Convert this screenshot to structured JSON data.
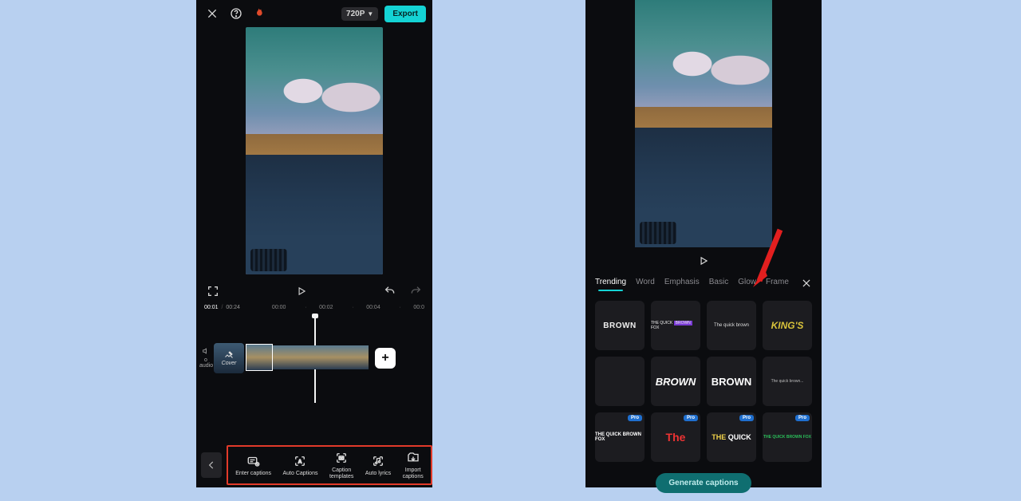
{
  "left": {
    "topbar": {
      "close_icon": "close",
      "help_icon": "help",
      "flame_icon": "flame",
      "resolution_label": "720P",
      "export_label": "Export"
    },
    "controls": {
      "fullscreen_icon": "fullscreen",
      "play_icon": "play",
      "undo_icon": "undo",
      "redo_icon": "redo"
    },
    "time": {
      "current": "00:01",
      "duration": "00:24",
      "ticks": [
        "00:00",
        "00:02",
        "00:04",
        "00:0"
      ]
    },
    "timeline": {
      "sound_toggle_label": "o audio",
      "cover_label": "Cover",
      "add_label": "+"
    },
    "toolbar": {
      "items": [
        {
          "icon": "enter-captions",
          "label": "Enter captions"
        },
        {
          "icon": "auto-captions",
          "label": "Auto Captions"
        },
        {
          "icon": "caption-templates",
          "label": "Caption\ntemplates"
        },
        {
          "icon": "auto-lyrics",
          "label": "Auto lyrics"
        },
        {
          "icon": "import-captions",
          "label": "Import\ncaptions"
        }
      ]
    }
  },
  "right": {
    "play_icon": "play",
    "tabs": [
      "Trending",
      "Word",
      "Emphasis",
      "Basic",
      "Glow",
      "Frame"
    ],
    "active_tab": "Trending",
    "close_icon": "close",
    "arrow_target": "Glow",
    "templates": [
      {
        "style": "brown",
        "text": "BROWN",
        "pro": false
      },
      {
        "style": "qbf",
        "text": "THE QUICK BROWN FOX",
        "pro": false
      },
      {
        "style": "tqb",
        "text": "The quick brown",
        "pro": false
      },
      {
        "style": "kings",
        "text": "KING'S",
        "pro": false
      },
      {
        "style": "blank",
        "text": "",
        "pro": false
      },
      {
        "style": "brown-it",
        "text": "BROWN",
        "pro": false
      },
      {
        "style": "brown-white",
        "text": "BROWN",
        "pro": false
      },
      {
        "style": "tqbsm",
        "text": "The quick brown...",
        "pro": false
      },
      {
        "style": "tqbw",
        "text": "THE QUICK BROWN FOX",
        "pro": true
      },
      {
        "style": "the-red",
        "text": "The",
        "pro": true
      },
      {
        "style": "the-quick",
        "text": "THE QUICK",
        "pro": true
      },
      {
        "style": "grn",
        "text": "THE QUICK BROWN FOX",
        "pro": true
      }
    ],
    "pro_label": "Pro",
    "generate_label": "Generate captions"
  }
}
